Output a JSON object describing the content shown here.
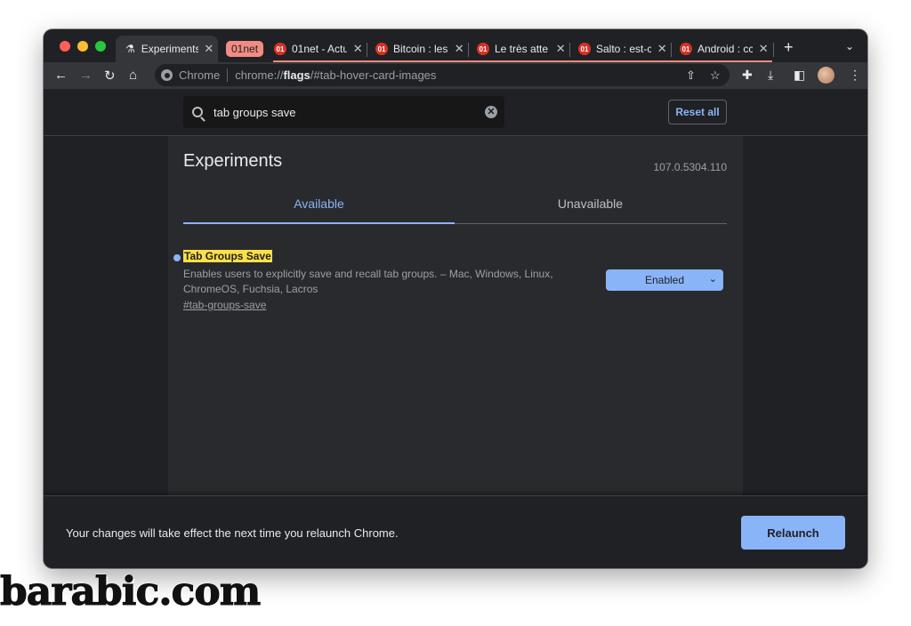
{
  "tabs": [
    {
      "title": "Experiments",
      "favicon": "flask-icon"
    },
    {
      "title": "01net - Actu",
      "favicon": "01net-icon"
    },
    {
      "title": "Bitcoin : les",
      "favicon": "01net-icon"
    },
    {
      "title": "Le très atte",
      "favicon": "01net-icon"
    },
    {
      "title": "Salto : est-c",
      "favicon": "01net-icon"
    },
    {
      "title": "Android : cc",
      "favicon": "01net-icon"
    }
  ],
  "tab_group_label": "01net",
  "tab_close": "✕",
  "favicon_text": "01",
  "omnibox": {
    "label": "Chrome",
    "scheme": "chrome://",
    "host": "flags",
    "rest": "/#tab-hover-card-images"
  },
  "search": {
    "value": "tab groups save"
  },
  "reset_label": "Reset all",
  "page_title": "Experiments",
  "version": "107.0.5304.110",
  "tab_available": "Available",
  "tab_unavailable": "Unavailable",
  "flag": {
    "name": "Tab Groups Save",
    "description": "Enables users to explicitly save and recall tab groups. – Mac, Windows, Linux, ChromeOS, Fuchsia, Lacros",
    "link": "#tab-groups-save",
    "selected": "Enabled"
  },
  "footer": {
    "message": "Your changes will take effect the next time you relaunch Chrome.",
    "relaunch_label": "Relaunch"
  },
  "watermark": "barabic.com",
  "colors": {
    "accent": "#8ab4f8",
    "highlight": "#fde047",
    "group": "#f28b82",
    "background": "#202124"
  }
}
